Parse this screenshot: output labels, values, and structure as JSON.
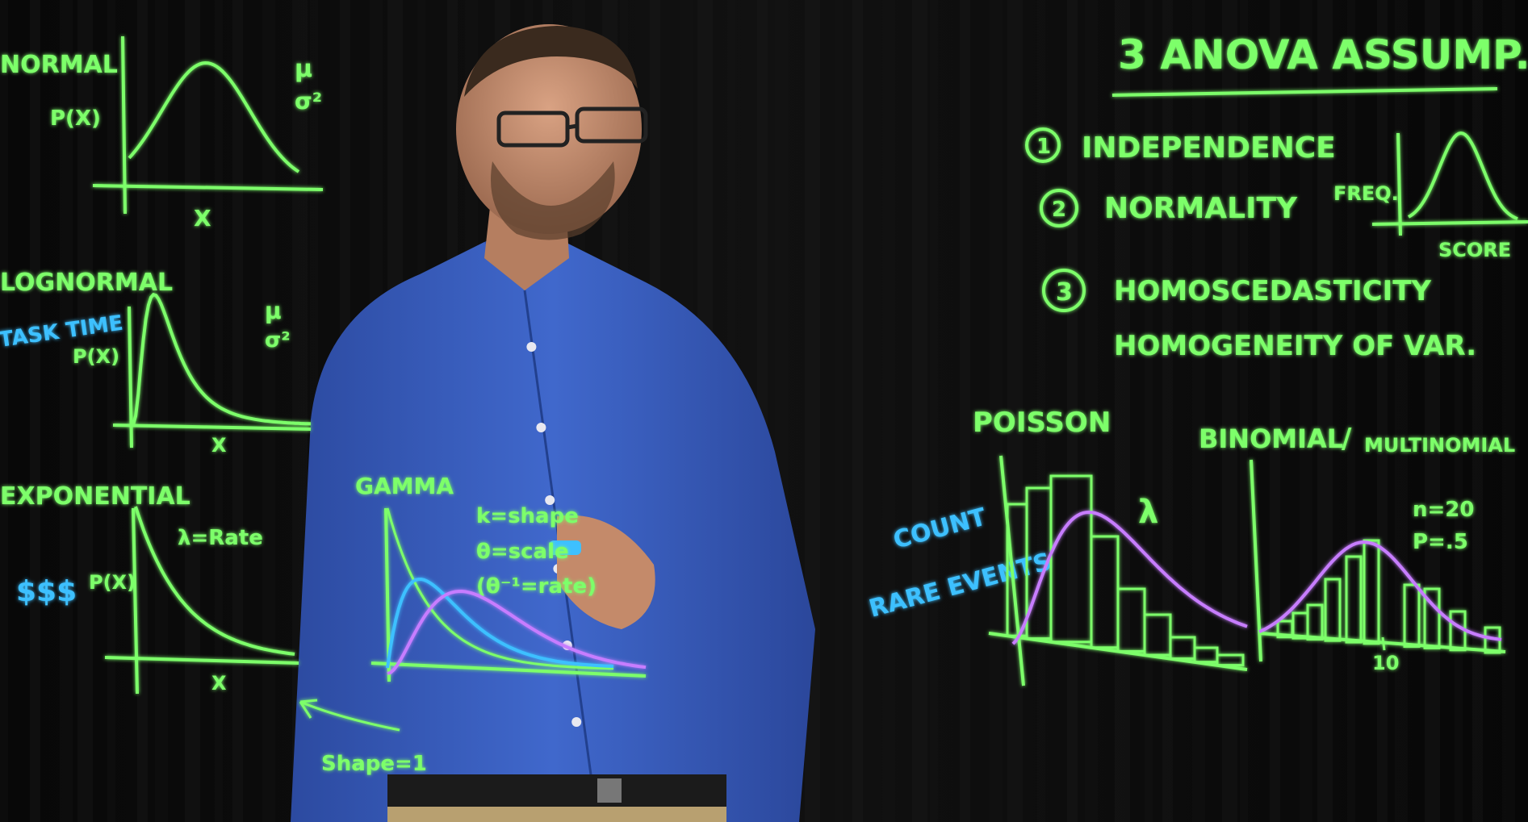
{
  "colors": {
    "green": "#7dff6a",
    "blue": "#3ec0ff",
    "purple": "#c77dff",
    "shirt": "#3a5fc0",
    "curtain": "#0a0a0a",
    "skin": "#c98e6e"
  },
  "left": {
    "normal_label": "NORMAL",
    "normal_y": "P(X)",
    "normal_x": "X",
    "normal_mu": "μ",
    "normal_sigma": "σ²",
    "lognormal_label": "LOGNORMAL",
    "lognormal_y": "P(X)",
    "lognormal_x": "X",
    "lognormal_mu": "μ",
    "lognormal_sigma": "σ²",
    "task_time": "TASK TIME",
    "exponential_label": "EXPONENTIAL",
    "exponential_y": "P(X)",
    "exponential_x": "X",
    "exponential_rate": "λ=Rate",
    "dollars": "$$$"
  },
  "gamma": {
    "label": "GAMMA",
    "k_shape": "k=shape",
    "theta_scale": "θ=scale",
    "theta_rate": "(θ⁻¹=rate)",
    "shape_one": "Shape=1"
  },
  "assumptions": {
    "title": "3 ANOVA ASSUMP.",
    "item1": "INDEPENDENCE",
    "item2": "NORMALITY",
    "item3": "HOMOSCEDASTICITY",
    "item3_sub": "HOMOGENEITY OF VAR.",
    "num1": "1",
    "num2": "2",
    "num3": "3",
    "freq_label": "FREQ.",
    "score_label": "SCORE"
  },
  "poisson": {
    "label": "POISSON",
    "lambda": "λ",
    "count": "COUNT",
    "rare_events": "RARE EVENTS"
  },
  "binomial": {
    "label": "BINOMIAL",
    "slash": "/",
    "multinomial": "MULTINOMIAL",
    "n": "n=20",
    "p": "P=.5",
    "tick": "10"
  }
}
